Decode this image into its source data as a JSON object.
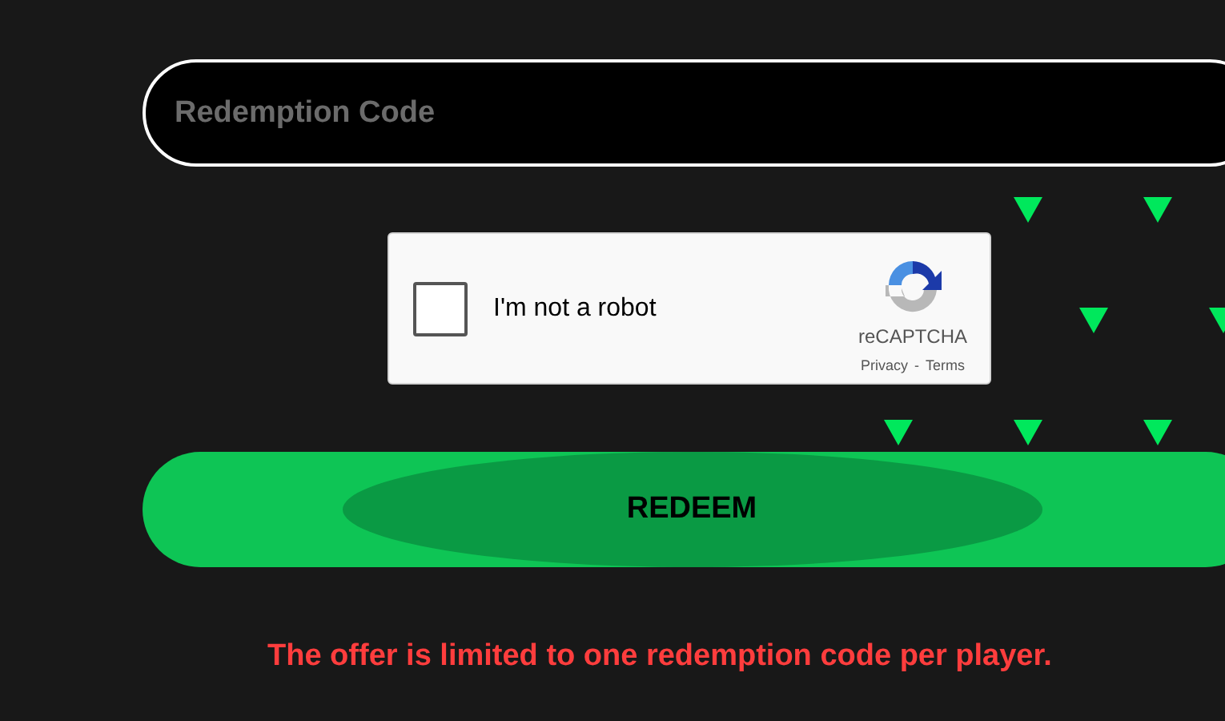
{
  "code_field": {
    "placeholder": "Redemption Code"
  },
  "captcha": {
    "checked": false,
    "label": "I'm not a robot",
    "brand": "reCAPTCHA",
    "privacy": "Privacy",
    "separator": "-",
    "terms": "Terms"
  },
  "redeem_button": {
    "label": "REDEEM"
  },
  "notice": "The offer is limited to one redemption code per player."
}
